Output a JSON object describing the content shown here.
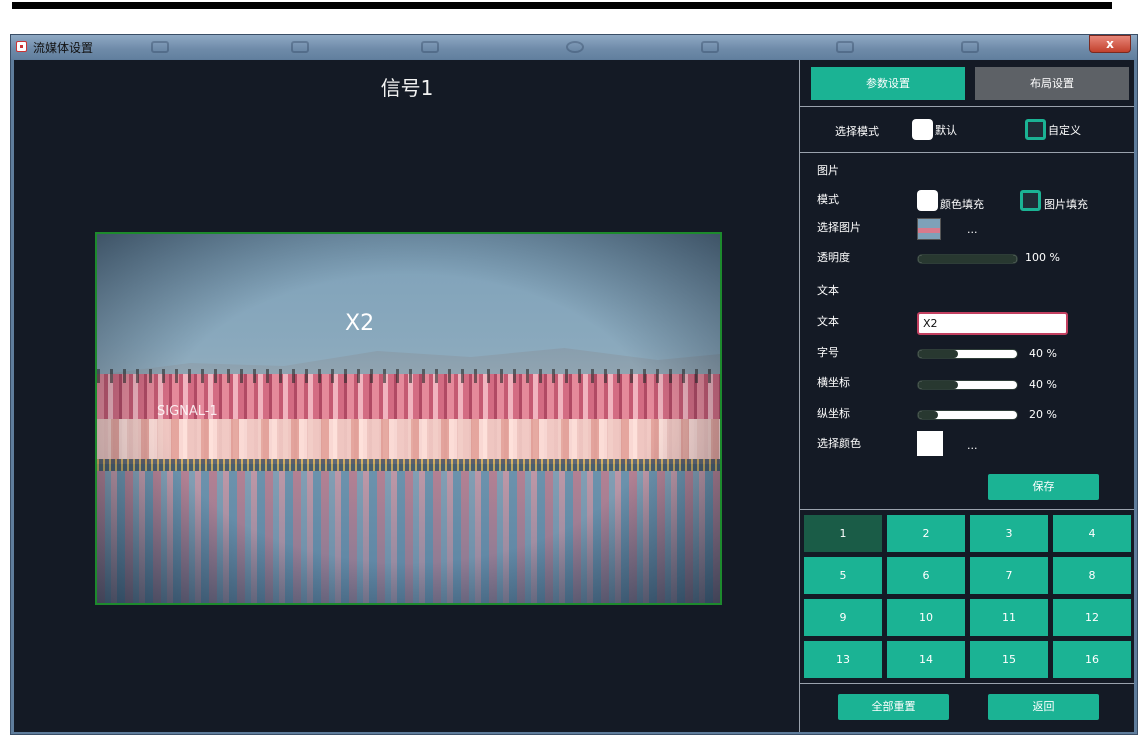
{
  "window": {
    "title": "流媒体设置",
    "close_label": "x"
  },
  "preview": {
    "title": "信号1",
    "overlay_text": "X2",
    "signal_label": "SIGNAL-1"
  },
  "tabs": [
    {
      "label": "参数设置",
      "active": true
    },
    {
      "label": "布局设置",
      "active": false
    }
  ],
  "mode": {
    "label": "选择模式",
    "options": [
      {
        "label": "默认",
        "checked": false
      },
      {
        "label": "自定义",
        "checked": true
      }
    ]
  },
  "image_section": {
    "heading": "图片",
    "mode_label": "模式",
    "mode_options": [
      {
        "label": "颜色填充",
        "checked": false
      },
      {
        "label": "图片填充",
        "checked": true
      }
    ],
    "select_image_label": "选择图片",
    "select_image_dots": "...",
    "opacity_label": "透明度",
    "opacity_value": 100,
    "opacity_text": "100 %"
  },
  "text_section": {
    "heading": "文本",
    "text_label": "文本",
    "text_value": "X2",
    "font_size_label": "字号",
    "font_size_value": 40,
    "font_size_text": "40 %",
    "x_label": "横坐标",
    "x_value": 40,
    "x_text": "40 %",
    "y_label": "纵坐标",
    "y_value": 20,
    "y_text": "20 %",
    "color_label": "选择颜色",
    "color_value": "#ffffff",
    "color_dots": "..."
  },
  "save_label": "保存",
  "grid_cells": [
    "1",
    "2",
    "3",
    "4",
    "5",
    "6",
    "7",
    "8",
    "9",
    "10",
    "11",
    "12",
    "13",
    "14",
    "15",
    "16"
  ],
  "active_cell": "1",
  "reset_all_label": "全部重置",
  "back_label": "返回",
  "colors": {
    "accent": "#1bb394",
    "active_cell": "#1a5c47",
    "background": "#141a25",
    "input_border": "#c24060"
  }
}
